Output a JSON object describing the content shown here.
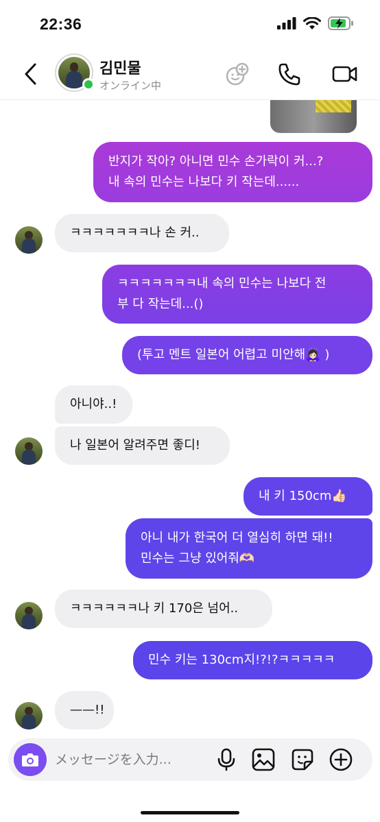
{
  "status_bar": {
    "time": "22:36",
    "icons": [
      "cellular-signal-icon",
      "wifi-icon",
      "battery-charging-icon"
    ]
  },
  "header": {
    "name": "김민물",
    "presence": "オンライン中",
    "icons": [
      "back-chevron-icon",
      "effects-icon",
      "phone-icon",
      "video-camera-icon"
    ]
  },
  "messages": [
    {
      "side": "out",
      "lines": [
        "반지가 작아? 아니면 민수 손가락이 커...?",
        "내 속의 민수는 나보다 키 작는데......"
      ]
    },
    {
      "side": "in",
      "lines": [
        "ㅋㅋㅋㅋㅋㅋㅋ나 손 커.."
      ]
    },
    {
      "side": "out",
      "lines": [
        "ㅋㅋㅋㅋㅋㅋㅋ내 속의 민수는 나보다 전",
        "부 다 작는데...()"
      ]
    },
    {
      "side": "out",
      "lines": [
        "(투고 멘트 일본어 어렵고 미안해🙇🏻‍♀️ )"
      ]
    },
    {
      "side": "in",
      "lines": [
        "아니야..!"
      ]
    },
    {
      "side": "in",
      "lines": [
        "나 일본어 알려주면 좋디!"
      ]
    },
    {
      "side": "out",
      "lines": [
        "내 키 150cm👍🏻"
      ]
    },
    {
      "side": "out",
      "lines": [
        "아니 내가 한국어 더 열심히 하면 돼!!",
        "민수는 그냥 있어줘🫶🏻"
      ]
    },
    {
      "side": "in",
      "lines": [
        "ㅋㅋㅋㅋㅋㅋ나 키 170은 넘어.."
      ]
    },
    {
      "side": "out",
      "lines": [
        "민수 키는 130cm지!?!?ㅋㅋㅋㅋㅋ"
      ]
    },
    {
      "side": "in",
      "lines": [
        "——!!"
      ]
    }
  ],
  "composer": {
    "placeholder": "メッセージを入力...",
    "icons": [
      "camera-icon",
      "microphone-icon",
      "gallery-icon",
      "sticker-icon",
      "plus-circle-icon"
    ]
  },
  "colors": {
    "accent_purple": "#7b4cf0",
    "bubble_gradient_top": "#a93ad8",
    "bubble_gradient_bottom": "#5a44ea",
    "incoming_bubble": "#efeff1",
    "online": "#2ec24a"
  }
}
